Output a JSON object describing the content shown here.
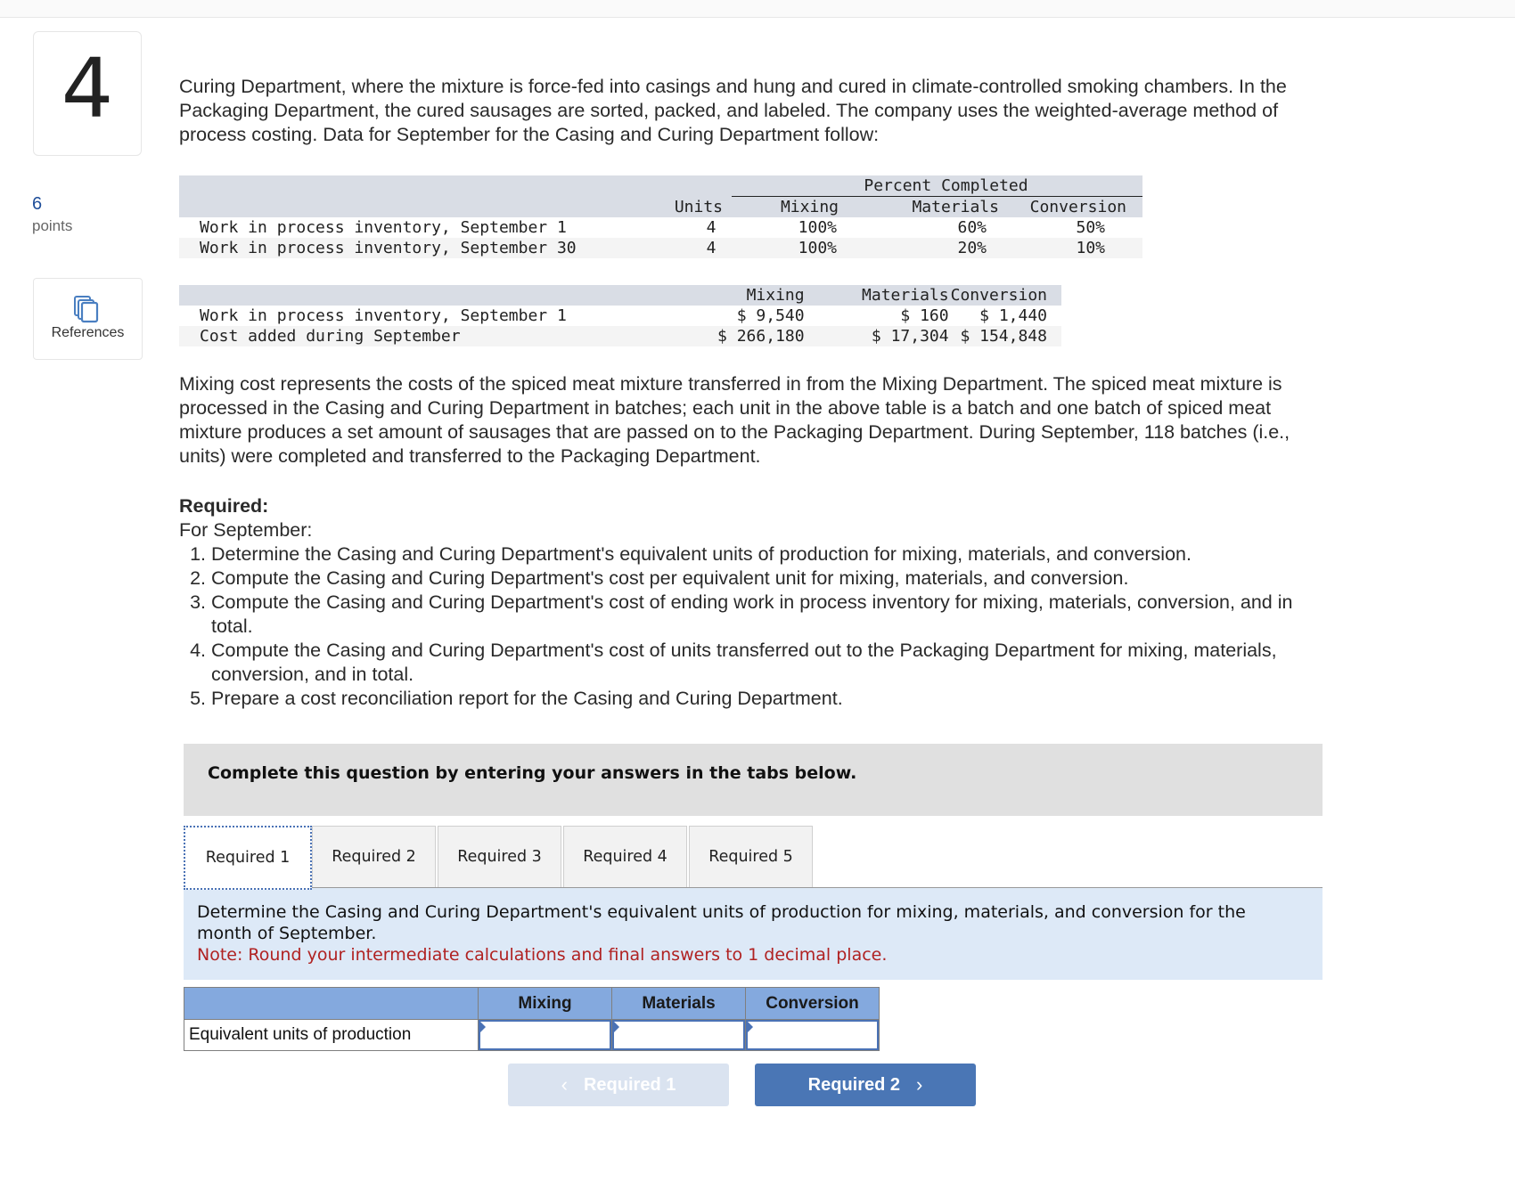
{
  "question": {
    "number": "4",
    "points_value": "6",
    "points_label": "points",
    "references_label": "References",
    "intro_lines": [
      "Curing Department, where the mixture is force-fed into casings and hung and cured in climate-controlled smoking chambers. In the",
      "Packaging Department, the cured sausages are sorted, packed, and labeled. The company uses the weighted-average method of",
      "process costing. Data for September for the Casing and Curing Department follow:"
    ]
  },
  "units_table": {
    "group_header": "Percent Completed",
    "columns": [
      "Units",
      "Mixing",
      "Materials",
      "Conversion"
    ],
    "rows": [
      {
        "label": "Work in process inventory, September 1",
        "units": "4",
        "mixing": "100%",
        "materials": "60%",
        "conversion": "50%"
      },
      {
        "label": "Work in process inventory, September 30",
        "units": "4",
        "mixing": "100%",
        "materials": "20%",
        "conversion": "10%"
      }
    ]
  },
  "cost_table": {
    "columns": [
      "Mixing",
      "Materials",
      "Conversion"
    ],
    "rows": [
      {
        "label": "Work in process inventory, September 1",
        "mixing": "$ 9,540",
        "materials": "$ 160",
        "conversion": "$ 1,440"
      },
      {
        "label": "Cost added during September",
        "mixing": "$ 266,180",
        "materials": "$ 17,304",
        "conversion": "$ 154,848"
      }
    ]
  },
  "mixing_paragraph_lines": [
    "Mixing cost represents the costs of the spiced meat mixture transferred in from the Mixing Department. The spiced meat mixture is",
    "processed in the Casing and Curing Department in batches; each unit in the above table is a batch and one batch of spiced meat",
    "mixture produces a set amount of sausages that are passed on to the Packaging Department. During September, 118 batches (i.e.,",
    "units) were completed and transferred to the Packaging Department."
  ],
  "required": {
    "heading": "Required:",
    "subheading": "For September:",
    "items": [
      {
        "num": "1.",
        "lines": [
          "Determine the Casing and Curing Department's equivalent units of production for mixing, materials, and conversion."
        ]
      },
      {
        "num": "2.",
        "lines": [
          "Compute the Casing and Curing Department's cost per equivalent unit for mixing, materials, and conversion."
        ]
      },
      {
        "num": "3.",
        "lines": [
          "Compute the Casing and Curing Department's cost of ending work in process inventory for mixing, materials, conversion, and in",
          "total."
        ]
      },
      {
        "num": "4.",
        "lines": [
          "Compute the Casing and Curing Department's cost of units transferred out to the Packaging Department for mixing, materials,",
          "conversion, and in total."
        ]
      },
      {
        "num": "5.",
        "lines": [
          "Prepare a cost reconciliation report for the Casing and Curing Department."
        ]
      }
    ]
  },
  "instruction_banner": "Complete this question by entering your answers in the tabs below.",
  "tabs": [
    "Required 1",
    "Required 2",
    "Required 3",
    "Required 4",
    "Required 5"
  ],
  "active_tab": "Required 1",
  "panel": {
    "prompt_lines": [
      "Determine the Casing and Curing Department's equivalent units of production for mixing, materials, and conversion for the",
      "month of September."
    ],
    "note": "Note: Round your intermediate calculations and final answers to 1 decimal place."
  },
  "answer_table": {
    "columns": [
      "Mixing",
      "Materials",
      "Conversion"
    ],
    "row_label": "Equivalent units of production",
    "values": {
      "mixing": "",
      "materials": "",
      "conversion": ""
    }
  },
  "nav": {
    "prev_label": "Required 1",
    "next_label": "Required 2"
  }
}
